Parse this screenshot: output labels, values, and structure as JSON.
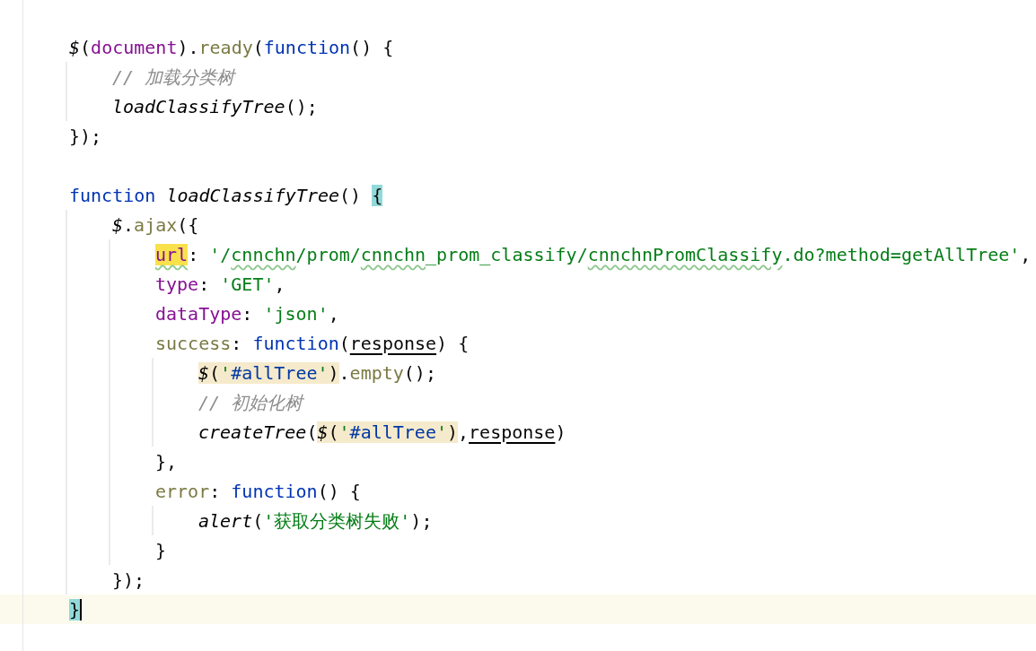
{
  "editor": {
    "lines": [
      {
        "kind": "code",
        "current": false,
        "tokens": [
          {
            "text": "$",
            "kind": "call"
          },
          {
            "text": "(",
            "kind": "plain"
          },
          {
            "text": "document",
            "kind": "property"
          },
          {
            "text": ").",
            "kind": "plain"
          },
          {
            "text": "ready",
            "kind": "method"
          },
          {
            "text": "(",
            "kind": "plain"
          },
          {
            "text": "function",
            "kind": "keyword"
          },
          {
            "text": "() {",
            "kind": "plain"
          }
        ],
        "children": [
          {
            "kind": "code",
            "current": false,
            "tokens": [
              {
                "text": "// 加载分类树",
                "kind": "comment"
              }
            ]
          },
          {
            "kind": "code",
            "current": false,
            "tokens": [
              {
                "text": "loadClassifyTree",
                "kind": "call"
              },
              {
                "text": "();",
                "kind": "plain"
              }
            ]
          }
        ]
      },
      {
        "kind": "code",
        "current": false,
        "tokens": [
          {
            "text": "});",
            "kind": "plain"
          }
        ]
      },
      {
        "kind": "blank"
      },
      {
        "kind": "code",
        "current": false,
        "tokens": [
          {
            "text": "function ",
            "kind": "keyword"
          },
          {
            "text": "loadClassifyTree",
            "kind": "call"
          },
          {
            "text": "() ",
            "kind": "plain"
          },
          {
            "text": "{",
            "kind": "plain",
            "brace_match": true
          }
        ],
        "children": [
          {
            "kind": "code",
            "current": false,
            "tokens": [
              {
                "text": "$",
                "kind": "call"
              },
              {
                "text": ".",
                "kind": "plain"
              },
              {
                "text": "ajax",
                "kind": "method"
              },
              {
                "text": "({",
                "kind": "plain"
              }
            ],
            "children": [
              {
                "kind": "code",
                "current": false,
                "tokens": [
                  {
                    "text": "url",
                    "kind": "property",
                    "search_match": true,
                    "typo": true
                  },
                  {
                    "text": ": ",
                    "kind": "plain"
                  },
                  {
                    "text": "'/",
                    "kind": "string"
                  },
                  {
                    "text": "cnnchn",
                    "kind": "string",
                    "typo": true
                  },
                  {
                    "text": "/prom/",
                    "kind": "string"
                  },
                  {
                    "text": "cnnchn",
                    "kind": "string",
                    "typo": true
                  },
                  {
                    "text": "_prom_classify/",
                    "kind": "string"
                  },
                  {
                    "text": "cnnchnPromClassify",
                    "kind": "string",
                    "typo": true
                  },
                  {
                    "text": ".do?method=getAllTree'",
                    "kind": "string"
                  },
                  {
                    "text": ",",
                    "kind": "plain"
                  }
                ]
              },
              {
                "kind": "code",
                "current": false,
                "tokens": [
                  {
                    "text": "type",
                    "kind": "property"
                  },
                  {
                    "text": ": ",
                    "kind": "plain"
                  },
                  {
                    "text": "'GET'",
                    "kind": "string"
                  },
                  {
                    "text": ",",
                    "kind": "plain"
                  }
                ]
              },
              {
                "kind": "code",
                "current": false,
                "tokens": [
                  {
                    "text": "dataType",
                    "kind": "property"
                  },
                  {
                    "text": ": ",
                    "kind": "plain"
                  },
                  {
                    "text": "'json'",
                    "kind": "string"
                  },
                  {
                    "text": ",",
                    "kind": "plain"
                  }
                ]
              },
              {
                "kind": "code",
                "current": false,
                "tokens": [
                  {
                    "text": "success",
                    "kind": "method"
                  },
                  {
                    "text": ": ",
                    "kind": "plain"
                  },
                  {
                    "text": "function",
                    "kind": "keyword"
                  },
                  {
                    "text": "(",
                    "kind": "plain"
                  },
                  {
                    "text": "response",
                    "kind": "plain",
                    "underlined": true
                  },
                  {
                    "text": ") {",
                    "kind": "plain"
                  }
                ],
                "children": [
                  {
                    "kind": "code",
                    "current": false,
                    "tokens": [
                      {
                        "text": "$",
                        "kind": "call",
                        "usage_match": true
                      },
                      {
                        "text": "(",
                        "kind": "plain",
                        "usage_match": true
                      },
                      {
                        "text": "'",
                        "kind": "string",
                        "usage_match": true
                      },
                      {
                        "text": "#allTree",
                        "kind": "selector",
                        "usage_match": true
                      },
                      {
                        "text": "'",
                        "kind": "string",
                        "usage_match": true
                      },
                      {
                        "text": ")",
                        "kind": "plain",
                        "usage_match": true
                      },
                      {
                        "text": ".",
                        "kind": "plain"
                      },
                      {
                        "text": "empty",
                        "kind": "method"
                      },
                      {
                        "text": "();",
                        "kind": "plain"
                      }
                    ]
                  },
                  {
                    "kind": "code",
                    "current": false,
                    "tokens": [
                      {
                        "text": "// 初始化树",
                        "kind": "comment"
                      }
                    ]
                  },
                  {
                    "kind": "code",
                    "current": false,
                    "tokens": [
                      {
                        "text": "createTree",
                        "kind": "call"
                      },
                      {
                        "text": "(",
                        "kind": "plain"
                      },
                      {
                        "text": "$",
                        "kind": "call",
                        "usage_match": true
                      },
                      {
                        "text": "(",
                        "kind": "plain",
                        "usage_match": true
                      },
                      {
                        "text": "'",
                        "kind": "string",
                        "usage_match": true
                      },
                      {
                        "text": "#allTree",
                        "kind": "selector",
                        "usage_match": true
                      },
                      {
                        "text": "'",
                        "kind": "string",
                        "usage_match": true
                      },
                      {
                        "text": ")",
                        "kind": "plain",
                        "usage_match": true
                      },
                      {
                        "text": ",",
                        "kind": "plain"
                      },
                      {
                        "text": "response",
                        "kind": "plain",
                        "underlined": true
                      },
                      {
                        "text": ")",
                        "kind": "plain"
                      }
                    ]
                  }
                ]
              },
              {
                "kind": "code",
                "current": false,
                "tokens": [
                  {
                    "text": "},",
                    "kind": "plain"
                  }
                ]
              },
              {
                "kind": "code",
                "current": false,
                "tokens": [
                  {
                    "text": "error",
                    "kind": "method"
                  },
                  {
                    "text": ": ",
                    "kind": "plain"
                  },
                  {
                    "text": "function",
                    "kind": "keyword"
                  },
                  {
                    "text": "() {",
                    "kind": "plain"
                  }
                ],
                "children": [
                  {
                    "kind": "code",
                    "current": false,
                    "tokens": [
                      {
                        "text": "alert",
                        "kind": "call"
                      },
                      {
                        "text": "(",
                        "kind": "plain"
                      },
                      {
                        "text": "'获取分类树失败'",
                        "kind": "string"
                      },
                      {
                        "text": ");",
                        "kind": "plain"
                      }
                    ]
                  }
                ]
              },
              {
                "kind": "code",
                "current": false,
                "tokens": [
                  {
                    "text": "}",
                    "kind": "plain"
                  }
                ]
              }
            ]
          },
          {
            "kind": "code",
            "current": false,
            "tokens": [
              {
                "text": "});",
                "kind": "plain"
              }
            ]
          }
        ]
      },
      {
        "kind": "code",
        "current": true,
        "tokens": [
          {
            "text": "}",
            "kind": "plain",
            "brace_match": true,
            "caret": true
          }
        ]
      }
    ]
  }
}
